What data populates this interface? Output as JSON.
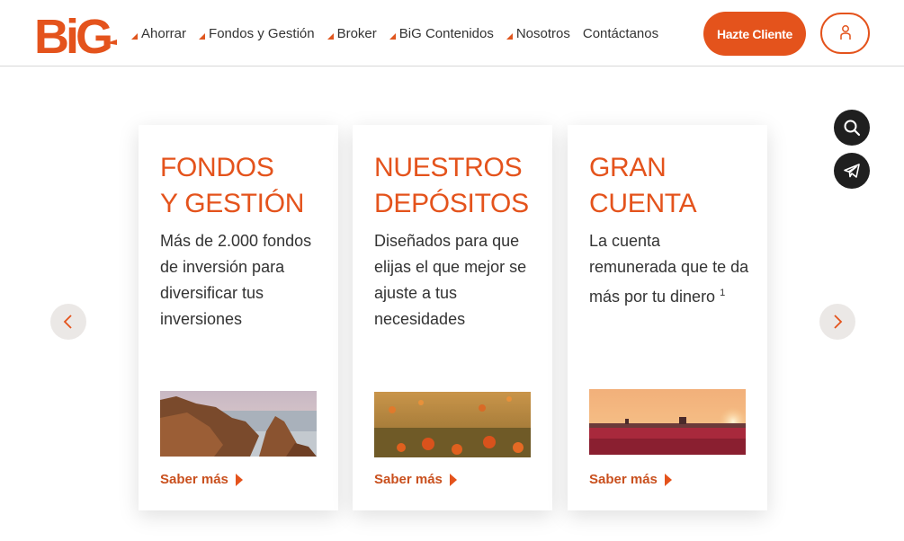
{
  "brand": {
    "logo_text": "BiG",
    "accent": "#e4531c"
  },
  "nav": {
    "items": [
      {
        "label": "Ahorrar",
        "caret": true
      },
      {
        "label": "Fondos y Gestión",
        "caret": true
      },
      {
        "label": "Broker",
        "caret": true
      },
      {
        "label": "BiG Contenidos",
        "caret": true
      },
      {
        "label": "Nosotros",
        "caret": true
      },
      {
        "label": "Contáctanos",
        "caret": false
      }
    ],
    "cta_label": "Hazte Cliente",
    "user_icon": "user-icon"
  },
  "floating": {
    "search_icon": "search-icon",
    "telegram_icon": "telegram-icon"
  },
  "cards": [
    {
      "title_line1": "FONDOS",
      "title_line2": "Y GESTIÓN",
      "desc": "Más de 2.000 fondos de inversión para diversificar tus inversiones",
      "desc_sup": "",
      "image": "coastal-rocks-image",
      "link": "Saber más"
    },
    {
      "title_line1": "NUESTROS",
      "title_line2": "DEPÓSITOS",
      "desc": "Diseñados para que elijas el que mejor se ajuste a tus necesidades",
      "desc_sup": "",
      "image": "poppy-field-image",
      "link": "Saber más"
    },
    {
      "title_line1": "GRAN",
      "title_line2": "CUENTA",
      "desc": "La cuenta remunerada que te da más por tu dinero",
      "desc_sup": "1",
      "image": "tulip-sunset-image",
      "link": "Saber más"
    }
  ],
  "carousel": {
    "prev_icon": "chevron-left-icon",
    "next_icon": "chevron-right-icon"
  }
}
